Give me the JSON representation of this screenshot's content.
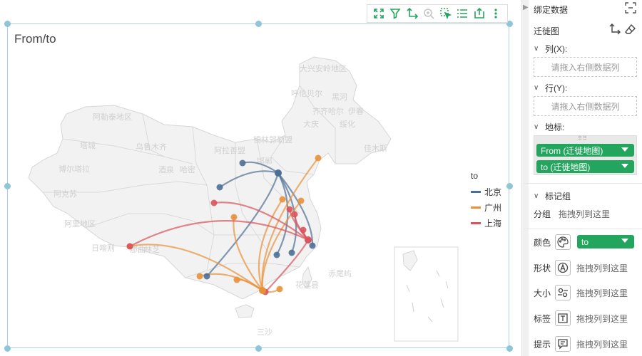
{
  "toolbar": {
    "icons": [
      "expand-icon",
      "filter-icon",
      "swap-axes-icon",
      "zoom-icon",
      "select-icon",
      "list-icon",
      "export-icon",
      "more-icon"
    ]
  },
  "chart": {
    "title": "From/to",
    "legend": {
      "title": "to",
      "items": [
        {
          "label": "北京",
          "color": "#4e6f95"
        },
        {
          "label": "广州",
          "color": "#e8913a"
        },
        {
          "label": "上海",
          "color": "#d9545d"
        }
      ]
    },
    "map_labels": [
      "大兴安岭地区",
      "呼伦贝尔",
      "黑河",
      "齐齐哈尔",
      "伊春",
      "大庆",
      "绥化",
      "锡林郭勒盟",
      "阿勒泰地区",
      "塔城",
      "博尔塔拉",
      "乌鲁木齐",
      "哈密",
      "酒泉",
      "阿克苏",
      "和田地区",
      "阿里地区",
      "日喀则",
      "那曲",
      "林芝",
      "赤尾屿",
      "花莲县",
      "三沙",
      "阿拉善盟",
      "邯郸",
      "佳木斯"
    ]
  },
  "chart_data": {
    "type": "flow-map",
    "title": "From/to",
    "legend_title": "to",
    "series": [
      {
        "name": "北京",
        "color": "#4e6f95"
      },
      {
        "name": "广州",
        "color": "#e8913a"
      },
      {
        "name": "上海",
        "color": "#d9545d"
      }
    ]
  },
  "panel": {
    "header": "绑定数据",
    "chart_type": "迁徙图",
    "columns_label": "列(X):",
    "columns_placeholder": "请拖入右侧数据列",
    "rows_label": "行(Y):",
    "rows_placeholder": "请拖入右侧数据列",
    "geo_label": "地标:",
    "geo_fields": [
      "From (迁徙地图)",
      "to (迁徙地图)"
    ],
    "marks_label": "标记组",
    "group_label": "分组",
    "group_placeholder": "拖拽列到这里",
    "color_label": "颜色",
    "color_value": "to",
    "shape_label": "形状",
    "shape_placeholder": "拖拽列到这里",
    "size_label": "大小",
    "size_placeholder": "拖拽列到这里",
    "label_label": "标签",
    "label_placeholder": "拖拽列到这里",
    "tooltip_label": "提示",
    "tooltip_placeholder": "拖拽列到这里"
  }
}
